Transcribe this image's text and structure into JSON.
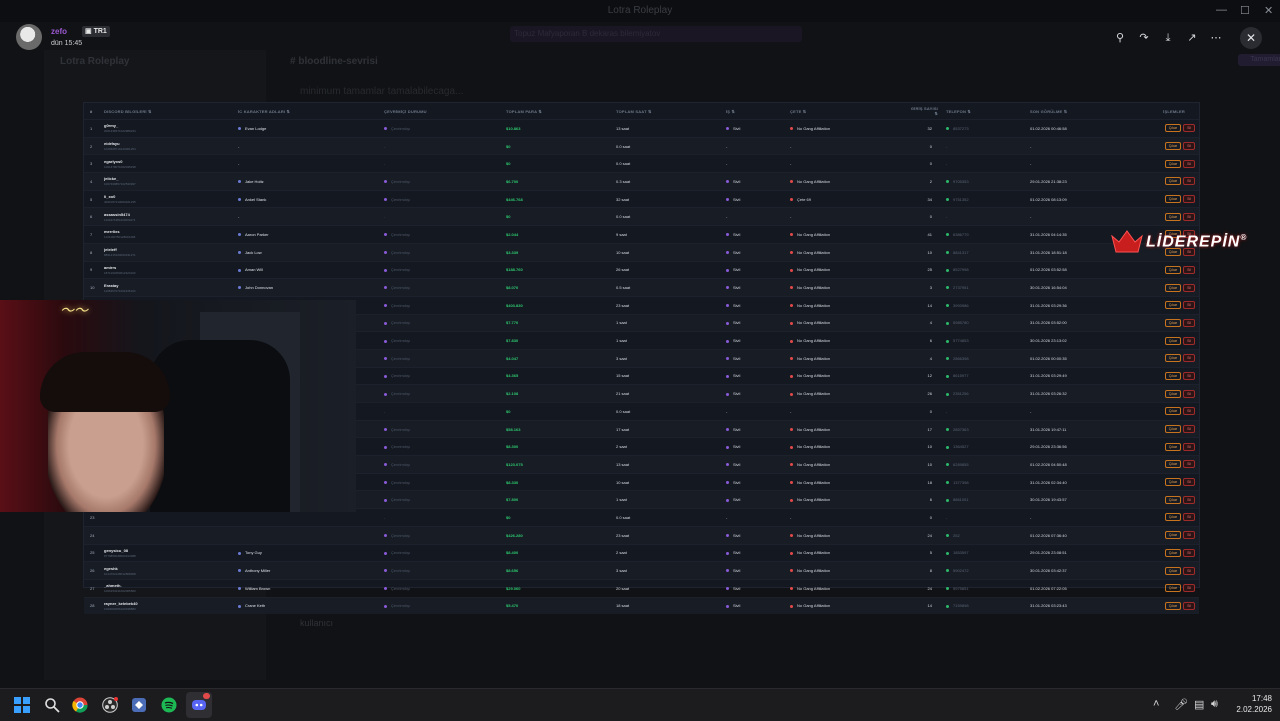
{
  "window": {
    "title": "Lotra Roleplay"
  },
  "background": {
    "server": "Lotra Roleplay",
    "channel": "# bloodline-sevrisi",
    "channel_desc": "minimum tamamlar tamalabilecaga...",
    "announcement": "Topuz Mafyaporan B dekaras bilemiyatov",
    "announcement_button": "Tamamlanmadi",
    "member": "kullanıcı"
  },
  "viewer": {
    "username": "zefo",
    "badge": "TR1",
    "time": "dün 15:45"
  },
  "table": {
    "headers": [
      "#",
      "DISCORD BİLGİLERİ",
      "İC KARAKTER ADLARI",
      "ÇEVRİMİÇİ DURUMU",
      "TOPLAM PARA",
      "TOPLAM SAAT",
      "İŞ",
      "ÇETE",
      "GİRİŞ SAYISI",
      "TELEFON",
      "SON GÖRÜLME",
      "İŞLEMLER"
    ],
    "action_labels": {
      "kick": "Çıkar",
      "delete": "Sil"
    },
    "rows": [
      {
        "n": "1",
        "dname": "g0rmy_",
        "did": "2001438371022989234",
        "ic": "Evan Lodge",
        "status": "Çevrimdışı",
        "money": "$10.863",
        "hours": "13 saat",
        "job": "Sivil",
        "gang": "No Gang Affiliation",
        "count": "32",
        "phone": "8537273",
        "last": "01.02.2026 00:46:58"
      },
      {
        "n": "2",
        "dname": "eidrfayu",
        "did": "1026608710120001254",
        "ic": "-",
        "status": "-",
        "money": "$0",
        "hours": "0.0 saat",
        "job": "-",
        "gang": "-",
        "count": "0",
        "phone": "-",
        "last": "-"
      },
      {
        "n": "3",
        "dname": "egarlyxs0",
        "did": "1001478071002035238",
        "ic": "-",
        "status": "-",
        "money": "$0",
        "hours": "0.0 saat",
        "job": "-",
        "gang": "-",
        "count": "0",
        "phone": "-",
        "last": "-"
      },
      {
        "n": "4",
        "dname": "jeiicke_",
        "did": "1007469857102533937",
        "ic": "Jake Holtz",
        "status": "Çevrimdışı",
        "money": "$6.700",
        "hours": "0.3 saat",
        "job": "Sivil",
        "gang": "No Gang Affiliation",
        "count": "2",
        "phone": "9705353",
        "last": "29.01.2026 21:38:23"
      },
      {
        "n": "5",
        "dname": "li_xo0",
        "did": "4001067210000221235",
        "ic": "Ankel Stank",
        "status": "Çevrimdışı",
        "money": "$446.768",
        "hours": "32 saat",
        "job": "Sivil",
        "gang": "Çete 69",
        "count": "34",
        "phone": "9751352",
        "last": "01.02.2026 08:13:09"
      },
      {
        "n": "6",
        "dname": "assassin5474",
        "did": "1100474380120003271",
        "ic": "-",
        "status": "-",
        "money": "$0",
        "hours": "0.0 saat",
        "job": "-",
        "gang": "-",
        "count": "0",
        "phone": "-",
        "last": "-"
      },
      {
        "n": "7",
        "dname": "merrlixs",
        "did": "1131100750128001398",
        "ic": "Aaron Parker",
        "status": "Çevrimdışı",
        "money": "$2.044",
        "hours": "9 saat",
        "job": "Sivil",
        "gang": "No Gang Affiliation",
        "count": "41",
        "phone": "6386779",
        "last": "31.01.2026 04:14:35"
      },
      {
        "n": "8",
        "dname": "jeleleff",
        "did": "8891215160000231271",
        "ic": "Jack Low",
        "status": "Çevrimdışı",
        "money": "$3.339",
        "hours": "10 saat",
        "job": "Sivil",
        "gang": "No Gang Affiliation",
        "count": "10",
        "phone": "8841317",
        "last": "31.01.2026 18:51:18"
      },
      {
        "n": "9",
        "dname": "amirrs",
        "did": "1871100250012320100",
        "ic": "Aman Will",
        "status": "Çevrimdışı",
        "money": "$188.760",
        "hours": "26 saat",
        "job": "Sivil",
        "gang": "No Gang Affiliation",
        "count": "25",
        "phone": "8527998",
        "last": "01.02.2026 03:52:58"
      },
      {
        "n": "10",
        "dname": "Erastay",
        "did": "1108467071002435100",
        "ic": "John Donnovan",
        "status": "Çevrimdışı",
        "money": "$8.070",
        "hours": "0.5 saat",
        "job": "Sivil",
        "gang": "No Gang Affiliation",
        "count": "3",
        "phone": "2737951",
        "last": "30.01.2026 16:54:04"
      },
      {
        "n": "11",
        "dname": "BabLax",
        "did": "2113187321082053385",
        "ic": "Zed Clark",
        "status": "Çevrimdışı",
        "money": "$403.830",
        "hours": "23 saat",
        "job": "Sivil",
        "gang": "No Gang Affiliation",
        "count": "14",
        "phone": "3993986",
        "last": "31.01.2026 03:29:36"
      },
      {
        "n": "12",
        "dname": "",
        "did": "",
        "ic": "",
        "status": "Çevrimdışı",
        "money": "$7.770",
        "hours": "1 saat",
        "job": "Sivil",
        "gang": "No Gang Affiliation",
        "count": "4",
        "phone": "5985780",
        "last": "31.01.2026 03:52:00"
      },
      {
        "n": "13",
        "dname": "",
        "did": "",
        "ic": "",
        "status": "Çevrimdışı",
        "money": "$7.830",
        "hours": "1 saat",
        "job": "Sivil",
        "gang": "No Gang Affiliation",
        "count": "6",
        "phone": "5774853",
        "last": "30.01.2026 23:13:02"
      },
      {
        "n": "14",
        "dname": "",
        "did": "",
        "ic": "",
        "status": "Çevrimdışı",
        "money": "$4.047",
        "hours": "3 saat",
        "job": "Sivil",
        "gang": "No Gang Affiliation",
        "count": "4",
        "phone": "2866398",
        "last": "01.02.2026 00:00:35"
      },
      {
        "n": "15",
        "dname": "",
        "did": "",
        "ic": "",
        "status": "Çevrimdışı",
        "money": "$4.365",
        "hours": "15 saat",
        "job": "Sivil",
        "gang": "No Gang Affiliation",
        "count": "12",
        "phone": "8615977",
        "last": "31.01.2026 03:29:49"
      },
      {
        "n": "16",
        "dname": "",
        "did": "",
        "ic": "",
        "status": "Çevrimdışı",
        "money": "$2.108",
        "hours": "21 saat",
        "job": "Sivil",
        "gang": "No Gang Affiliation",
        "count": "26",
        "phone": "2351256",
        "last": "31.01.2026 03:26:32"
      },
      {
        "n": "17",
        "dname": "",
        "did": "",
        "ic": "",
        "status": "-",
        "money": "$0",
        "hours": "0.0 saat",
        "job": "-",
        "gang": "-",
        "count": "0",
        "phone": "-",
        "last": "-"
      },
      {
        "n": "18",
        "dname": "",
        "did": "",
        "ic": "",
        "status": "Çevrimdışı",
        "money": "$58.163",
        "hours": "17 saat",
        "job": "Sivil",
        "gang": "No Gang Affiliation",
        "count": "17",
        "phone": "2857363",
        "last": "31.01.2026 19:47:11"
      },
      {
        "n": "19",
        "dname": "",
        "did": "",
        "ic": "",
        "status": "Çevrimdışı",
        "money": "$8.300",
        "hours": "2 saat",
        "job": "Sivil",
        "gang": "No Gang Affiliation",
        "count": "10",
        "phone": "1364527",
        "last": "29.01.2026 23:36:56"
      },
      {
        "n": "20",
        "dname": "",
        "did": "",
        "ic": "",
        "status": "Çevrimdışı",
        "money": "$123.075",
        "hours": "13 saat",
        "job": "Sivil",
        "gang": "No Gang Affiliation",
        "count": "10",
        "phone": "6289855",
        "last": "01.02.2026 04:50:48"
      },
      {
        "n": "21",
        "dname": "",
        "did": "",
        "ic": "",
        "status": "Çevrimdışı",
        "money": "$8.330",
        "hours": "10 saat",
        "job": "Sivil",
        "gang": "No Gang Affiliation",
        "count": "18",
        "phone": "1377398",
        "last": "31.01.2026 02:34:40"
      },
      {
        "n": "22",
        "dname": "",
        "did": "",
        "ic": "",
        "status": "Çevrimdışı",
        "money": "$7.800",
        "hours": "1 saat",
        "job": "Sivil",
        "gang": "No Gang Affiliation",
        "count": "6",
        "phone": "8861051",
        "last": "30.01.2026 19:43:57"
      },
      {
        "n": "23",
        "dname": "",
        "did": "",
        "ic": "",
        "status": "-",
        "money": "$0",
        "hours": "0.0 saat",
        "job": "-",
        "gang": "-",
        "count": "0",
        "phone": "-",
        "last": "-"
      },
      {
        "n": "24",
        "dname": "",
        "did": "",
        "ic": "",
        "status": "Çevrimdışı",
        "money": "$426.280",
        "hours": "23 saat",
        "job": "Sivil",
        "gang": "No Gang Affiliation",
        "count": "24",
        "phone": "252",
        "last": "01.02.2026 07:36:40"
      },
      {
        "n": "25",
        "dname": "genysicu_08",
        "did": "8779850048000313388",
        "ic": "Tony Guy",
        "status": "Çevrimdışı",
        "money": "$8.400",
        "hours": "2 saat",
        "job": "Sivil",
        "gang": "No Gang Affiliation",
        "count": "5",
        "phone": "1853597",
        "last": "29.01.2026 23:08:51"
      },
      {
        "n": "26",
        "dname": "egeshk",
        "did": "1014702128012808008",
        "ic": "Anthony Miller",
        "status": "Çevrimdışı",
        "money": "$8.656",
        "hours": "3 saat",
        "job": "Sivil",
        "gang": "No Gang Affiliation",
        "count": "8",
        "phone": "5902472",
        "last": "30.01.2026 03:42:37"
      },
      {
        "n": "27",
        "dname": "_ahmeth.",
        "did": "1006153241002005500",
        "ic": "William Brown",
        "status": "Çevrimdışı",
        "money": "$29.060",
        "hours": "20 saat",
        "job": "Sivil",
        "gang": "No Gang Affiliation",
        "count": "24",
        "phone": "5975851",
        "last": "01.02.2026 07:22:05"
      },
      {
        "n": "28",
        "dname": "rayner_kelebek40",
        "did": "1000000056100038880",
        "ic": "Crane Keth",
        "status": "Çevrimdışı",
        "money": "$5.470",
        "hours": "18 saat",
        "job": "Sivil",
        "gang": "No Gang Affiliation",
        "count": "14",
        "phone": "7159898",
        "last": "31.01.2026 03:23:43"
      }
    ]
  },
  "logo": {
    "text": "LİDEREPİN",
    "mark": "®"
  },
  "taskbar": {
    "time": "17:48",
    "date": "2.02.2026"
  },
  "colors": {
    "accent_money": "#2ecc71",
    "kick": "#f0a550",
    "delete": "#ec6b6b",
    "username": "#9b59d0"
  }
}
